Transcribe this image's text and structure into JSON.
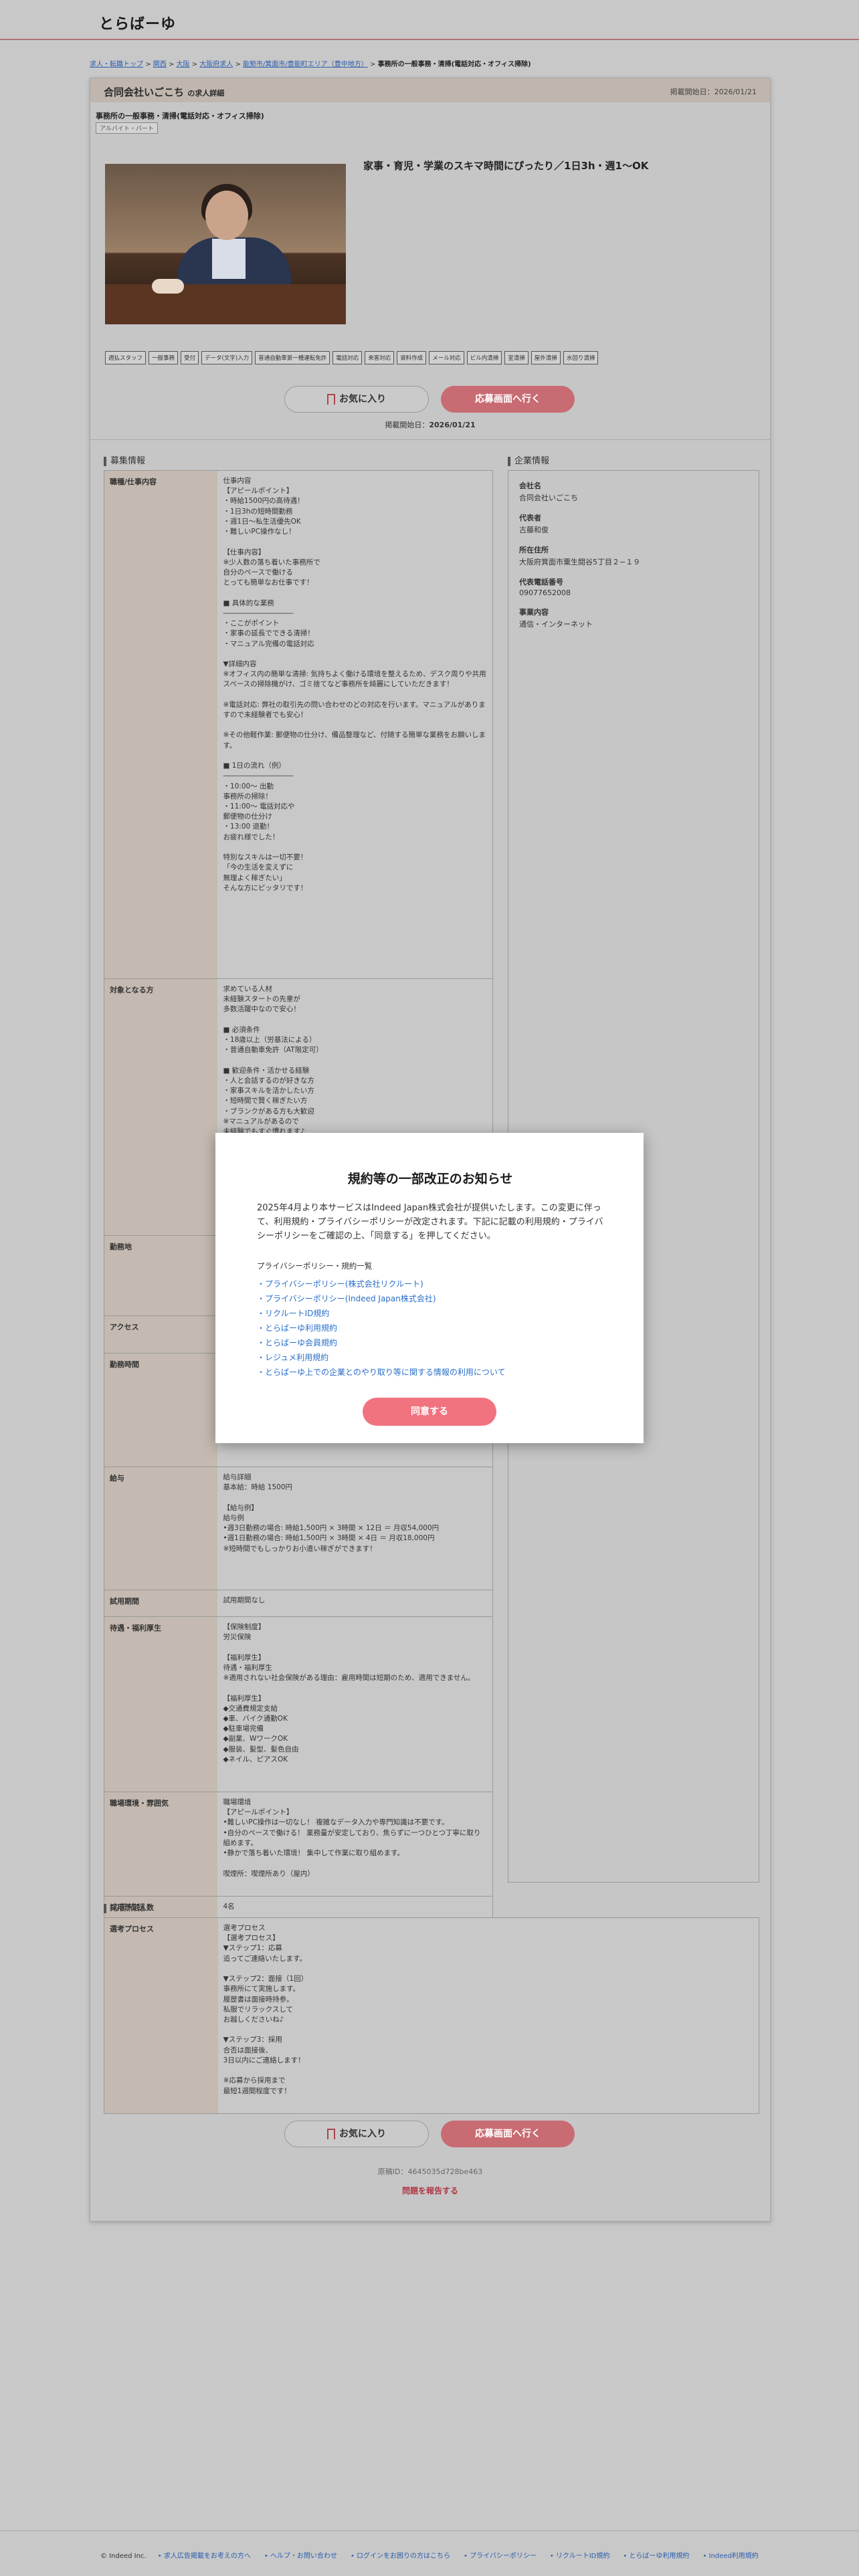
{
  "site": {
    "logo": "とらばーゆ"
  },
  "breadcrumb": {
    "items": [
      "求人・転職トップ",
      "関西",
      "大阪",
      "大阪府求人",
      "能勢市/箕面市/豊能町エリア（豊中地方）"
    ],
    "separator": ">",
    "current": "事務所の一般事務・清掃(電話対応・オフィス掃除)"
  },
  "job": {
    "company": "合同会社いごこち",
    "company_suffix": "の求人詳細",
    "posted_label": "掲載開始日：",
    "posted_date": "2026/01/21",
    "title": "事務所の一般事務・清掃(電話対応・オフィス掃除)",
    "employment_type": "アルバイト・パート",
    "headline": "家事・育児・学業のスキマ時間にぴったり／1日3h・週1〜OK",
    "tags": [
      "週払スタッフ",
      "一般事務",
      "受付",
      "データ(文字)入力",
      "普通自動車第一種運転免許",
      "電話対応",
      "来客対応",
      "資料作成",
      "メール対応",
      "ビル内清掃",
      "室清掃",
      "屋外清掃",
      "水回り清掃"
    ],
    "favorite_label": "お気に入り",
    "apply_label": "応募画面へ行く",
    "posted_mid_label": "掲載開始日：",
    "posted_mid_date": "2026/01/21",
    "job_id": "原稿ID：4645035d728be463",
    "report_label": "問題を報告する"
  },
  "recruit": {
    "section_title": "募集情報",
    "rows": [
      {
        "label": "職種/仕事内容",
        "value": "仕事内容\n【アピールポイント】\n・時給1500円の高待遇！\n・1日3hの短時間勤務\n・週1日〜私生活優先OK\n・難しいPC操作なし！\n\n【仕事内容】\n※少人数の落ち着いた事務所で\n自分のペースで働ける\nとっても簡単なお仕事です！\n\n■ 具体的な業務\n――――――――――\n・ここがポイント\n・家事の延長でできる清掃！\n・マニュアル完備の電話対応\n\n▼詳細内容\n※オフィス内の簡単な清掃: 気持ちよく働ける環境を整えるため、デスク周りや共用スペースの掃除機がけ、ゴミ捨てなど事務所を綺麗にしていただきます！\n\n※電話対応: 弊社の取引先の問い合わせのどの対応を行います。マニュアルがありますので未経験者でも安心！\n\n※その他軽作業: 郵便物の仕分け、備品整理など、付随する簡単な業務をお願いします。\n\n■ 1日の流れ（例）\n――――――――――\n・10:00〜 出勤\n事務所の掃除！\n・11:00〜 電話対応や\n郵便物の仕分け\n・13:00 退勤！\nお疲れ様でした！\n\n特別なスキルは一切不要！\n「今の生活を変えずに\n無理よく稼ぎたい」\nそんな方にピッタリです！"
      },
      {
        "label": "対象となる方",
        "value": "求めている人材\n未経験スタートの先輩が\n多数活躍中なので安心！\n\n■ 必須条件\n・18歳以上（労基法による）\n・普通自動車免許（AT限定可）\n\n■ 歓迎条件・活かせる経験\n・人と会話するのが好きな方\n・家事スキルを活かしたい方\n・短時間で賢く稼ぎたい方\n・ブランクがある方も大歓迎\n※マニュアルがあるので\n未経験でもすぐ慣れます♪\n\n•学歴・経験不問！未経験の方、ブランクのある方も大歓迎です。\n•主婦の方、シニアの方、Wワーク・副業希望の方、学生の方、どなたでも大歓迎です！"
      },
      {
        "label": "勤務地",
        "value": ""
      },
      {
        "label": "アクセス",
        "value": ""
      },
      {
        "label": "勤務時間",
        "value": ""
      },
      {
        "label": "給与",
        "value": "給与詳細\n基本給：時給 1500円\n\n【給与例】\n給与例\n•週3日勤務の場合: 時給1,500円 × 3時間 × 12日 ＝ 月収54,000円\n•週1日勤務の場合: 時給1,500円 × 3時間 × 4日 ＝ 月収18,000円\n※短時間でもしっかりお小遣い稼ぎができます！"
      },
      {
        "label": "試用期間",
        "value": "試用期間なし"
      },
      {
        "label": "待遇・福利厚生",
        "value": "【保険制度】\n労災保険\n\n【福利厚生】\n待遇・福利厚生\n※適用されない社会保険がある理由：雇用時間は短期のため、適用できません。\n\n【福利厚生】\n◆交通費規定支給\n◆車、バイク通勤OK\n◆駐車場完備\n◆副業、WワークOK\n◆服装、髪型、髪色自由\n◆ネイル、ピアスOK"
      },
      {
        "label": "職場環境・雰囲気",
        "value": "職場環境\n【アピールポイント】\n•難しいPC操作は一切なし！ 複雑なデータ入力や専門知識は不要です。\n•自分のペースで働ける！ 業務量が安定しており、焦らずに一つひとつ丁寧に取り組めます。\n•静かで落ち着いた環境！ 集中して作業に取り組めます。\n\n喫煙所：喫煙所あり（屋内）"
      },
      {
        "label": "採用予定人数",
        "value": "4名"
      }
    ]
  },
  "company_info": {
    "section_title": "企業情報",
    "items": [
      {
        "label": "会社名",
        "value": "合同会社いごこち"
      },
      {
        "label": "代表者",
        "value": "古藤和俊"
      },
      {
        "label": "所在住所",
        "value": "大阪府箕面市粟生間谷5丁目２−１９"
      },
      {
        "label": "代表電話番号",
        "value": "09077652008"
      },
      {
        "label": "事業内容",
        "value": "通信・インターネット"
      }
    ]
  },
  "apply_info": {
    "section_title": "応募情報",
    "rows": [
      {
        "label": "選考プロセス",
        "value": "選考プロセス\n【選考プロセス】\n▼ステップ1：応募\n追ってご連絡いたします。\n\n▼ステップ2：面接（1回）\n事務所にて実施します。\n履歴書は面接時持参。\n私服でリラックスして\nお越しくださいね♪\n\n▼ステップ3：採用\n合否は面接後、\n3日以内にご連絡します！\n\n※応募から採用まで\n最短1週間程度です！"
      }
    ]
  },
  "modal": {
    "title": "規約等の一部改正のお知らせ",
    "body": "2025年4月より本サービスはIndeed Japan株式会社が提供いたします。この変更に伴って、利用規約・プライバシーポリシーが改定されます。下記に記載の利用規約・プライバシーポリシーをご確認の上、「同意する」を押してください。",
    "list_title": "プライバシーポリシー・規約一覧",
    "links": [
      "・プライバシーポリシー(株式会社リクルート)",
      "・プライバシーポリシー(Indeed Japan株式会社)",
      "・リクルートID規約",
      "・とらばーゆ利用規約",
      "・とらばーゆ会員規約",
      "・レジュメ利用規約",
      "・とらばーゆ上での企業とのやり取り等に関する情報の利用について"
    ],
    "agree_label": "同意する"
  },
  "footer": {
    "copyright": "© Indeed Inc.",
    "links": [
      "求人広告掲載をお考えの方へ",
      "ヘルプ・お問い合わせ",
      "ログインをお困りの方はこちら",
      "プライバシーポリシー",
      "リクルートID規約",
      "とらばーゆ利用規約",
      "Indeed利用規約"
    ]
  }
}
